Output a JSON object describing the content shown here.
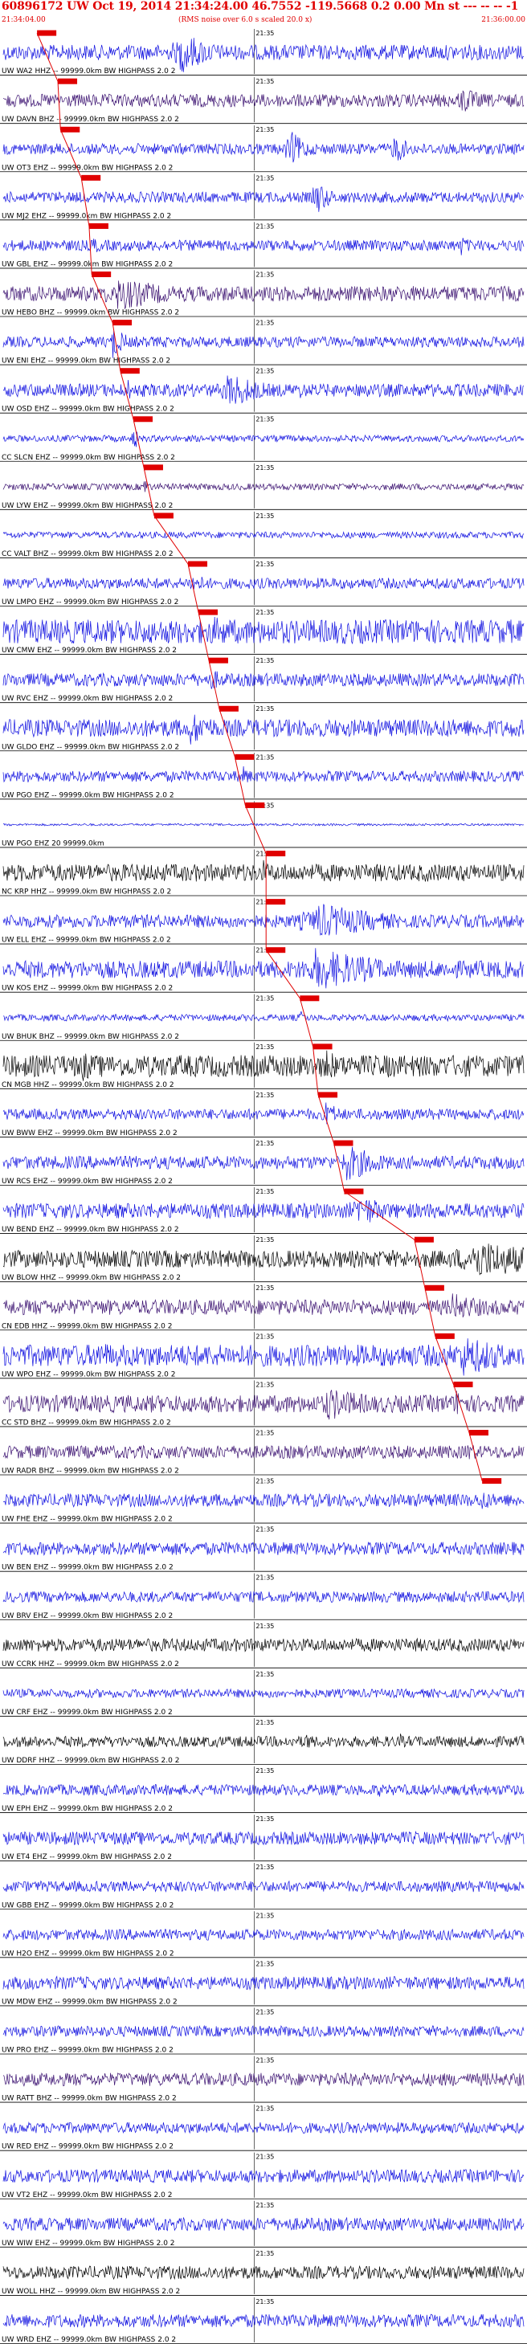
{
  "header": {
    "title": "60896172 UW Oct 19, 2014 21:34:24.00   46.7552  -119.5668  0.2 0.00 Mn st --- -- --   -1",
    "start_time": "21:34:04.00",
    "rms_note": "(RMS noise over 6.0 s scaled 20.0 x)",
    "end_time": "21:36:00.00",
    "minute_mark": "21:35"
  },
  "colors": {
    "blue": "#1010e0",
    "purple": "#3a1070",
    "black": "#000000",
    "pick": "#e00000",
    "text_red": "#e00000"
  },
  "chart_data": {
    "type": "line",
    "title": "",
    "x_start": "21:34:04.00",
    "x_end": "21:36:00.00",
    "minute_mark": "21:35",
    "traces": [
      {
        "label": "UW WA2 HHZ -- 99999.0km BW  HIGHPASS  2.0  2",
        "color": "blue",
        "pick": 0.065,
        "amp": 0.35,
        "events": [
          [
            0.1,
            0.25,
            0.04
          ],
          [
            0.34,
            1.0,
            0.03
          ],
          [
            0.89,
            0.4,
            0.03
          ]
        ]
      },
      {
        "label": "UW DAVN BHZ -- 99999.0km BW  HIGHPASS  2.0  2",
        "color": "purple",
        "pick": 0.105,
        "amp": 0.3,
        "events": [
          [
            0.18,
            0.3,
            0.03
          ],
          [
            0.88,
            0.7,
            0.02
          ]
        ]
      },
      {
        "label": "UW OT3 EHZ -- 99999.0km BW  HIGHPASS  2.0  2",
        "color": "blue",
        "pick": 0.11,
        "amp": 0.25,
        "events": [
          [
            0.55,
            0.9,
            0.015
          ],
          [
            0.75,
            0.8,
            0.012
          ]
        ]
      },
      {
        "label": "UW MJ2 EHZ -- 99999.0km BW  HIGHPASS  2.0  2",
        "color": "blue",
        "pick": 0.15,
        "amp": 0.25,
        "events": [
          [
            0.6,
            0.9,
            0.012
          ]
        ]
      },
      {
        "label": "UW GBL EHZ -- 99999.0km BW  HIGHPASS  2.0  2",
        "color": "blue",
        "pick": 0.165,
        "amp": 0.25,
        "events": [
          [
            0.17,
            0.5,
            0.01
          ],
          [
            0.88,
            0.5,
            0.01
          ]
        ]
      },
      {
        "label": "UW HEBO BHZ -- 99999.0km BW  HIGHPASS  2.0  2",
        "color": "purple",
        "pick": 0.17,
        "amp": 0.35,
        "events": [
          [
            0.22,
            0.8,
            0.05
          ]
        ]
      },
      {
        "label": "UW ENI EHZ -- 99999.0km BW  HIGHPASS  2.0  2",
        "color": "blue",
        "pick": 0.21,
        "amp": 0.25,
        "events": [
          [
            0.21,
            0.8,
            0.012
          ]
        ]
      },
      {
        "label": "UW OSD EHZ -- 99999.0km BW  HIGHPASS  2.0  2",
        "color": "blue",
        "pick": 0.225,
        "amp": 0.3,
        "events": [
          [
            0.24,
            0.5,
            0.01
          ],
          [
            0.43,
            0.9,
            0.03
          ],
          [
            0.57,
            0.4,
            0.015
          ],
          [
            0.69,
            0.6,
            0.01
          ]
        ]
      },
      {
        "label": "CC SLCN EHZ -- 99999.0km BW  HIGHPASS  2.0  2",
        "color": "blue",
        "pick": 0.25,
        "amp": 0.15,
        "events": [
          [
            0.25,
            0.6,
            0.005
          ]
        ]
      },
      {
        "label": "UW LYW EHZ -- 99999.0km BW  HIGHPASS  2.0  2",
        "color": "purple",
        "pick": 0.27,
        "amp": 0.15,
        "events": [
          [
            0.27,
            0.5,
            0.005
          ]
        ]
      },
      {
        "label": "CC VALT BHZ -- 99999.0km BW  HIGHPASS  2.0  2",
        "color": "blue",
        "pick": 0.29,
        "amp": 0.15,
        "events": []
      },
      {
        "label": "UW LMPO EHZ -- 99999.0km BW  HIGHPASS  2.0  2",
        "color": "blue",
        "pick": 0.355,
        "amp": 0.25,
        "events": [
          [
            0.36,
            0.5,
            0.02
          ]
        ]
      },
      {
        "label": "UW CMW EHZ -- 99999.0km BW  HIGHPASS  2.0  2",
        "color": "blue",
        "pick": 0.375,
        "amp": 0.55,
        "events": [
          [
            0.4,
            0.7,
            0.08
          ],
          [
            0.65,
            0.6,
            0.05
          ]
        ]
      },
      {
        "label": "UW RVC EHZ -- 99999.0km BW  HIGHPASS  2.0  2",
        "color": "blue",
        "pick": 0.395,
        "amp": 0.3,
        "events": [
          [
            0.4,
            0.5,
            0.02
          ]
        ]
      },
      {
        "label": "UW GLDO EHZ -- 99999.0km BW  HIGHPASS  2.0  2",
        "color": "blue",
        "pick": 0.415,
        "amp": 0.4,
        "events": [
          [
            0.36,
            0.8,
            0.03
          ],
          [
            0.84,
            0.6,
            0.02
          ]
        ]
      },
      {
        "label": "UW PGO EHZ -- 99999.0km BW  HIGHPASS  2.0  2",
        "color": "blue",
        "pick": 0.445,
        "amp": 0.25,
        "events": [
          [
            0.04,
            0.5,
            0.01
          ],
          [
            0.46,
            0.5,
            0.01
          ]
        ]
      },
      {
        "label": "UW PGO EHZ 20 99999.0km",
        "color": "blue",
        "pick": 0.465,
        "amp": 0.05,
        "events": []
      },
      {
        "label": "NC KRP HHZ -- 99999.0km BW  HIGHPASS  2.0  2",
        "color": "black",
        "pick": 0.505,
        "amp": 0.4,
        "events": [
          [
            0.5,
            0.6,
            0.01
          ]
        ]
      },
      {
        "label": "UW ELL EHZ -- 99999.0km BW  HIGHPASS  2.0  2",
        "color": "blue",
        "pick": 0.505,
        "amp": 0.3,
        "events": [
          [
            0.6,
            0.9,
            0.06
          ]
        ]
      },
      {
        "label": "UW KOS EHZ -- 99999.0km BW  HIGHPASS  2.0  2",
        "color": "blue",
        "pick": 0.505,
        "amp": 0.4,
        "events": [
          [
            0.6,
            1.0,
            0.07
          ]
        ]
      },
      {
        "label": "UW BHUK BHZ -- 99999.0km BW  HIGHPASS  2.0  2",
        "color": "blue",
        "pick": 0.57,
        "amp": 0.15,
        "events": [
          [
            0.57,
            0.4,
            0.005
          ]
        ]
      },
      {
        "label": "CN MGB HHZ -- 99999.0km BW  HIGHPASS  2.0  2",
        "color": "black",
        "pick": 0.595,
        "amp": 0.5,
        "events": [
          [
            0.15,
            0.8,
            0.02
          ],
          [
            0.62,
            1.0,
            0.01
          ],
          [
            0.74,
            0.6,
            0.02
          ]
        ]
      },
      {
        "label": "UW BWW EHZ -- 99999.0km BW  HIGHPASS  2.0  2",
        "color": "blue",
        "pick": 0.605,
        "amp": 0.25,
        "events": [
          [
            0.62,
            0.6,
            0.015
          ]
        ]
      },
      {
        "label": "UW RCS EHZ -- 99999.0km BW  HIGHPASS  2.0  2",
        "color": "blue",
        "pick": 0.635,
        "amp": 0.3,
        "events": [
          [
            0.66,
            0.9,
            0.03
          ]
        ]
      },
      {
        "label": "UW BEND EHZ -- 99999.0km BW  HIGHPASS  2.0  2",
        "color": "blue",
        "pick": 0.655,
        "amp": 0.35,
        "events": [
          [
            0.68,
            0.8,
            0.03
          ]
        ]
      },
      {
        "label": "UW BLOW HHZ -- 99999.0km BW  HIGHPASS  2.0  2",
        "color": "black",
        "pick": 0.79,
        "amp": 0.4,
        "events": [
          [
            0.9,
            1.0,
            0.07
          ]
        ]
      },
      {
        "label": "CN EDB HHZ -- 99999.0km BW  HIGHPASS  2.0  2",
        "color": "purple",
        "pick": 0.81,
        "amp": 0.35,
        "events": [
          [
            0.86,
            0.7,
            0.04
          ]
        ]
      },
      {
        "label": "UW WPO EHZ -- 99999.0km BW  HIGHPASS  2.0  2",
        "color": "blue",
        "pick": 0.83,
        "amp": 0.5,
        "events": [
          [
            0.18,
            0.7,
            0.04
          ],
          [
            0.88,
            1.0,
            0.05
          ]
        ]
      },
      {
        "label": "CC STD BHZ -- 99999.0km BW  HIGHPASS  2.0  2",
        "color": "purple",
        "pick": 0.865,
        "amp": 0.4,
        "events": [
          [
            0.62,
            0.8,
            0.05
          ],
          [
            0.87,
            0.7,
            0.02
          ]
        ]
      },
      {
        "label": "UW RADR BHZ -- 99999.0km BW  HIGHPASS  2.0  2",
        "color": "purple",
        "pick": 0.895,
        "amp": 0.3,
        "events": [
          [
            0.89,
            0.6,
            0.01
          ]
        ]
      },
      {
        "label": "UW FHE EHZ -- 99999.0km BW  HIGHPASS  2.0  2",
        "color": "blue",
        "pick": 0.92,
        "amp": 0.3,
        "events": [
          [
            0.92,
            0.6,
            0.01
          ]
        ]
      },
      {
        "label": "UW BEN EHZ -- 99999.0km BW  HIGHPASS  2.0  2",
        "color": "blue",
        "pick": null,
        "amp": 0.3,
        "events": []
      },
      {
        "label": "UW BRV EHZ -- 99999.0km BW  HIGHPASS  2.0  2",
        "color": "blue",
        "pick": null,
        "amp": 0.25,
        "events": []
      },
      {
        "label": "UW CCRK HHZ -- 99999.0km BW  HIGHPASS  2.0  2",
        "color": "black",
        "pick": null,
        "amp": 0.3,
        "events": []
      },
      {
        "label": "UW CRF EHZ -- 99999.0km BW  HIGHPASS  2.0  2",
        "color": "blue",
        "pick": null,
        "amp": 0.2,
        "events": [
          [
            0.05,
            0.4,
            0.005
          ]
        ]
      },
      {
        "label": "UW DDRF HHZ -- 99999.0km BW  HIGHPASS  2.0  2",
        "color": "black",
        "pick": null,
        "amp": 0.25,
        "events": [
          [
            0.58,
            0.5,
            0.01
          ],
          [
            0.76,
            0.5,
            0.005
          ]
        ]
      },
      {
        "label": "UW EPH EHZ -- 99999.0km BW  HIGHPASS  2.0  2",
        "color": "blue",
        "pick": null,
        "amp": 0.25,
        "events": [
          [
            0.72,
            0.4,
            0.005
          ]
        ]
      },
      {
        "label": "UW ET4 EHZ -- 99999.0km BW  HIGHPASS  2.0  2",
        "color": "blue",
        "pick": null,
        "amp": 0.3,
        "events": []
      },
      {
        "label": "UW GBB EHZ -- 99999.0km BW  HIGHPASS  2.0  2",
        "color": "blue",
        "pick": null,
        "amp": 0.25,
        "events": []
      },
      {
        "label": "UW H2O EHZ -- 99999.0km BW  HIGHPASS  2.0  2",
        "color": "blue",
        "pick": null,
        "amp": 0.25,
        "events": []
      },
      {
        "label": "UW MDW EHZ -- 99999.0km BW  HIGHPASS  2.0  2",
        "color": "blue",
        "pick": null,
        "amp": 0.3,
        "events": []
      },
      {
        "label": "UW PRO EHZ -- 99999.0km BW  HIGHPASS  2.0  2",
        "color": "blue",
        "pick": null,
        "amp": 0.25,
        "events": []
      },
      {
        "label": "UW RATT BHZ -- 99999.0km BW  HIGHPASS  2.0  2",
        "color": "purple",
        "pick": null,
        "amp": 0.3,
        "events": []
      },
      {
        "label": "UW RED EHZ -- 99999.0km BW  HIGHPASS  2.0  2",
        "color": "blue",
        "pick": null,
        "amp": 0.25,
        "events": []
      },
      {
        "label": "UW VT2 EHZ -- 99999.0km BW  HIGHPASS  2.0  2",
        "color": "blue",
        "pick": null,
        "amp": 0.3,
        "events": []
      },
      {
        "label": "UW WIW EHZ -- 99999.0km BW  HIGHPASS  2.0  2",
        "color": "blue",
        "pick": null,
        "amp": 0.3,
        "events": []
      },
      {
        "label": "UW WOLL HHZ -- 99999.0km BW  HIGHPASS  2.0  2",
        "color": "black",
        "pick": null,
        "amp": 0.3,
        "events": []
      },
      {
        "label": "UW WRD EHZ -- 99999.0km BW  HIGHPASS  2.0  2",
        "color": "blue",
        "pick": null,
        "amp": 0.3,
        "events": []
      }
    ]
  }
}
